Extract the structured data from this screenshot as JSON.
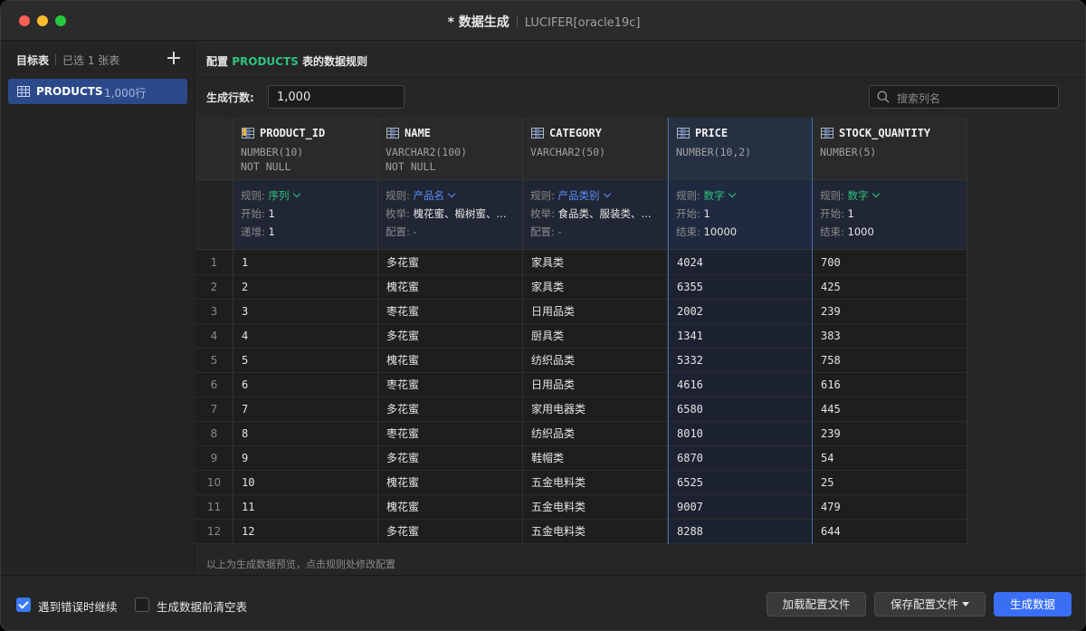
{
  "window": {
    "title": "* 数据生成",
    "connection": "LUCIFER[oracle19c]"
  },
  "sidebar": {
    "title": "目标表",
    "count": "已选 1 张表",
    "items": [
      {
        "name": "PRODUCTS",
        "rows": "1,000行"
      }
    ]
  },
  "config": {
    "title_prefix": "配置",
    "table_name": "PRODUCTS",
    "title_suffix": "表的数据规则",
    "rows_label": "生成行数:",
    "rows_value": "1,000",
    "search_placeholder": "搜索列名",
    "footnote": "以上为生成数据预览，点击规则处修改配置"
  },
  "columns": [
    {
      "name": "PRODUCT_ID",
      "type": "NUMBER(10)",
      "constraint": "NOT NULL",
      "icon": "primary-key-column-icon",
      "rule": [
        {
          "label": "规则:",
          "value": "序列",
          "style": "green",
          "dropdown": true
        },
        {
          "label": "开始:",
          "value": "1",
          "style": "val"
        },
        {
          "label": "递增:",
          "value": "1",
          "style": "val"
        }
      ],
      "values": [
        "1",
        "2",
        "3",
        "4",
        "5",
        "6",
        "7",
        "8",
        "9",
        "10",
        "11",
        "12"
      ]
    },
    {
      "name": "NAME",
      "type": "VARCHAR2(100)",
      "constraint": "NOT NULL",
      "icon": "column-icon",
      "rule": [
        {
          "label": "规则:",
          "value": "产品名",
          "style": "link",
          "dropdown": true
        },
        {
          "label": "枚举:",
          "value": "槐花蜜、椴树蜜、...",
          "style": "val"
        },
        {
          "label": "配置:",
          "value": "-",
          "style": "dash"
        }
      ],
      "values": [
        "多花蜜",
        "槐花蜜",
        "枣花蜜",
        "多花蜜",
        "槐花蜜",
        "枣花蜜",
        "多花蜜",
        "枣花蜜",
        "多花蜜",
        "槐花蜜",
        "槐花蜜",
        "多花蜜"
      ]
    },
    {
      "name": "CATEGORY",
      "type": "VARCHAR2(50)",
      "constraint": "",
      "icon": "column-icon",
      "rule": [
        {
          "label": "规则:",
          "value": "产品类别",
          "style": "link",
          "dropdown": true
        },
        {
          "label": "枚举:",
          "value": "食品类、服装类、...",
          "style": "val"
        },
        {
          "label": "配置:",
          "value": "-",
          "style": "dash"
        }
      ],
      "values": [
        "家具类",
        "家具类",
        "日用品类",
        "厨具类",
        "纺织品类",
        "日用品类",
        "家用电器类",
        "纺织品类",
        "鞋帽类",
        "五金电料类",
        "五金电料类",
        "五金电料类"
      ]
    },
    {
      "name": "PRICE",
      "type": "NUMBER(10,2)",
      "constraint": "",
      "icon": "column-icon",
      "selected": true,
      "rule": [
        {
          "label": "规则:",
          "value": "数字",
          "style": "green",
          "dropdown": true
        },
        {
          "label": "开始:",
          "value": "1",
          "style": "val"
        },
        {
          "label": "结束:",
          "value": "10000",
          "style": "val"
        }
      ],
      "values": [
        "4024",
        "6355",
        "2002",
        "1341",
        "5332",
        "4616",
        "6580",
        "8010",
        "6870",
        "6525",
        "9007",
        "8288"
      ]
    },
    {
      "name": "STOCK_QUANTITY",
      "type": "NUMBER(5)",
      "constraint": "",
      "icon": "column-icon",
      "rule": [
        {
          "label": "规则:",
          "value": "数字",
          "style": "green",
          "dropdown": true
        },
        {
          "label": "开始:",
          "value": "1",
          "style": "val"
        },
        {
          "label": "结束:",
          "value": "1000",
          "style": "val"
        }
      ],
      "values": [
        "700",
        "425",
        "239",
        "383",
        "758",
        "616",
        "445",
        "239",
        "54",
        "25",
        "479",
        "644"
      ]
    }
  ],
  "row_numbers": [
    "1",
    "2",
    "3",
    "4",
    "5",
    "6",
    "7",
    "8",
    "9",
    "10",
    "11",
    "12"
  ],
  "footer": {
    "continue_on_error": {
      "label": "遇到错误时继续",
      "checked": true
    },
    "truncate_before": {
      "label": "生成数据前清空表",
      "checked": false
    },
    "load_button": "加载配置文件",
    "save_button": "保存配置文件",
    "generate_button": "生成数据"
  },
  "colors": {
    "accent_green": "#2ec27e",
    "link_blue": "#5b8cff",
    "primary_button": "#3a6ff5",
    "sidebar_selected": "#2c4a8a"
  }
}
